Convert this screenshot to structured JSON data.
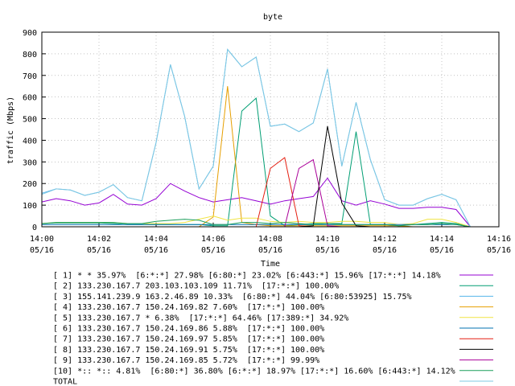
{
  "chart_data": {
    "type": "line",
    "title": "byte",
    "xlabel": "Time",
    "ylabel": "traffic (Mbps)",
    "ylim": [
      0,
      900
    ],
    "xlim": [
      0,
      16
    ],
    "grid": true,
    "legend_placement": "bottom",
    "yticks": [
      "0",
      "100",
      "200",
      "300",
      "400",
      "500",
      "600",
      "700",
      "800",
      "900"
    ],
    "xticks": [
      {
        "time": "14:00",
        "date": "05/16"
      },
      {
        "time": "14:02",
        "date": "05/16"
      },
      {
        "time": "14:04",
        "date": "05/16"
      },
      {
        "time": "14:06",
        "date": "05/16"
      },
      {
        "time": "14:08",
        "date": "05/16"
      },
      {
        "time": "14:10",
        "date": "05/16"
      },
      {
        "time": "14:12",
        "date": "05/16"
      },
      {
        "time": "14:14",
        "date": "05/16"
      },
      {
        "time": "14:16",
        "date": "05/16"
      }
    ],
    "x": [
      0,
      0.5,
      1,
      1.5,
      2,
      2.5,
      3,
      3.5,
      4,
      4.5,
      5,
      5.5,
      6,
      6.5,
      7,
      7.5,
      8,
      8.5,
      9,
      9.5,
      10,
      10.5,
      11,
      11.5,
      12,
      12.5,
      13,
      13.5,
      14,
      14.5,
      15
    ],
    "series": [
      {
        "color": "#9400d3",
        "values": [
          115,
          130,
          120,
          100,
          110,
          150,
          105,
          100,
          130,
          200,
          165,
          135,
          115,
          125,
          135,
          120,
          105,
          120,
          130,
          140,
          225,
          120,
          100,
          120,
          105,
          85,
          85,
          90,
          90,
          80,
          0
        ]
      },
      {
        "color": "#009e73",
        "values": [
          15,
          18,
          18,
          18,
          18,
          15,
          10,
          10,
          10,
          10,
          10,
          10,
          5,
          5,
          535,
          595,
          50,
          5,
          10,
          15,
          15,
          15,
          440,
          10,
          10,
          5,
          10,
          15,
          20,
          15,
          0
        ]
      },
      {
        "color": "#56b4e9",
        "values": [
          155,
          175,
          170,
          145,
          160,
          195,
          135,
          120,
          390,
          750,
          510,
          175,
          280,
          820,
          740,
          785,
          465,
          475,
          440,
          480,
          730,
          280,
          575,
          310,
          125,
          100,
          100,
          130,
          150,
          125,
          0
        ]
      },
      {
        "color": "#e69f00",
        "values": [
          0,
          0,
          0,
          0,
          0,
          0,
          0,
          0,
          0,
          0,
          0,
          0,
          45,
          650,
          20,
          10,
          5,
          5,
          5,
          5,
          5,
          5,
          5,
          5,
          5,
          5,
          0,
          0,
          0,
          0,
          0
        ]
      },
      {
        "color": "#f0e442",
        "values": [
          15,
          20,
          20,
          20,
          20,
          20,
          15,
          15,
          15,
          15,
          20,
          35,
          50,
          30,
          40,
          40,
          25,
          20,
          25,
          20,
          20,
          25,
          25,
          20,
          20,
          10,
          15,
          35,
          35,
          20,
          0
        ]
      },
      {
        "color": "#0072b2",
        "values": [
          10,
          10,
          10,
          10,
          10,
          10,
          10,
          10,
          10,
          10,
          10,
          10,
          10,
          10,
          10,
          10,
          10,
          10,
          10,
          10,
          10,
          10,
          10,
          10,
          10,
          10,
          10,
          10,
          10,
          10,
          0
        ]
      },
      {
        "color": "#e51e10",
        "values": [
          0,
          0,
          0,
          0,
          0,
          0,
          0,
          0,
          0,
          0,
          0,
          0,
          0,
          0,
          0,
          0,
          270,
          320,
          5,
          0,
          0,
          0,
          0,
          0,
          0,
          0,
          0,
          0,
          0,
          0,
          0
        ]
      },
      {
        "color": "#000000",
        "values": [
          0,
          0,
          0,
          0,
          0,
          0,
          0,
          0,
          0,
          0,
          0,
          0,
          0,
          0,
          0,
          0,
          0,
          0,
          0,
          5,
          465,
          110,
          5,
          0,
          0,
          0,
          0,
          0,
          0,
          0,
          0
        ]
      },
      {
        "color": "#aa0099",
        "values": [
          0,
          0,
          0,
          0,
          0,
          0,
          0,
          0,
          0,
          0,
          0,
          0,
          0,
          0,
          0,
          0,
          0,
          0,
          270,
          310,
          5,
          0,
          0,
          0,
          0,
          0,
          0,
          0,
          0,
          0,
          0
        ]
      },
      {
        "color": "#1a9e5a",
        "values": [
          15,
          20,
          20,
          20,
          20,
          20,
          15,
          15,
          25,
          30,
          35,
          30,
          10,
          10,
          20,
          20,
          15,
          20,
          15,
          10,
          15,
          10,
          10,
          10,
          10,
          5,
          10,
          10,
          15,
          10,
          0
        ]
      },
      {
        "color": "#7ec8e3",
        "values": [
          150,
          175,
          170,
          145,
          160,
          195,
          135,
          120,
          390,
          750,
          510,
          175,
          280,
          820,
          740,
          785,
          465,
          475,
          440,
          480,
          730,
          280,
          575,
          310,
          125,
          100,
          100,
          130,
          150,
          125,
          0
        ]
      }
    ]
  },
  "legend": [
    {
      "text": "[ 1] * * 35.97%  [6:*:*] 27.98% [6:80:*] 23.02% [6:443:*] 15.96% [17:*:*] 14.18%",
      "color": "#9400d3"
    },
    {
      "text": "[ 2] 133.230.167.7 203.103.103.109 11.71%  [17:*:*] 100.00%",
      "color": "#009e73"
    },
    {
      "text": "[ 3] 155.141.239.9 163.2.46.89 10.33%  [6:80:*] 44.04% [6:80:53925] 15.75%",
      "color": "#56b4e9"
    },
    {
      "text": "[ 4] 133.230.167.7 150.24.169.82 7.60%  [17:*:*] 100.00%",
      "color": "#e69f00"
    },
    {
      "text": "[ 5] 133.230.167.7 * 6.38%  [17:*:*] 64.46% [17:389:*] 34.92%",
      "color": "#f0e442"
    },
    {
      "text": "[ 6] 133.230.167.7 150.24.169.86 5.88%  [17:*:*] 100.00%",
      "color": "#0072b2"
    },
    {
      "text": "[ 7] 133.230.167.7 150.24.169.97 5.85%  [17:*:*] 100.00%",
      "color": "#e51e10"
    },
    {
      "text": "[ 8] 133.230.167.7 150.24.169.91 5.75%  [17:*:*] 100.00%",
      "color": "#000000"
    },
    {
      "text": "[ 9] 133.230.167.7 150.24.169.85 5.72%  [17:*:*] 99.99%",
      "color": "#aa0099"
    },
    {
      "text": "[10] *:: *:: 4.81%  [6:80:*] 36.80% [6:*:*] 18.97% [17:*:*] 16.60% [6:443:*] 14.12%",
      "color": "#1a9e5a"
    },
    {
      "text": "TOTAL",
      "color": "#7ec8e3"
    }
  ]
}
